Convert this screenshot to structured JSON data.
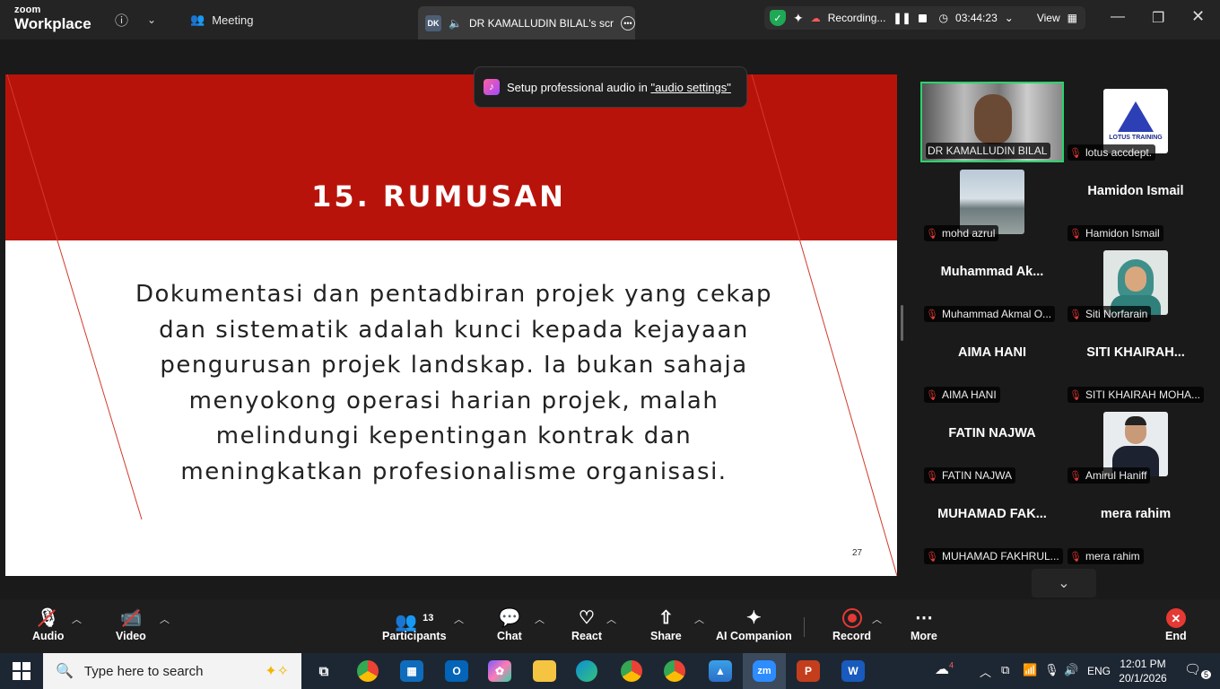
{
  "app": {
    "brand_top": "zoom",
    "brand_bottom": "Workplace"
  },
  "topbar": {
    "meeting_label": "Meeting",
    "share_initials": "DK",
    "share_title": "DR KAMALLUDIN BILAL's scr",
    "recording_label": "Recording...",
    "timer": "03:44:23",
    "view_label": "View"
  },
  "toast": {
    "text": "Setup professional audio in ",
    "link": "\"audio settings\""
  },
  "slide": {
    "title": "15. RUMUSAN",
    "body": "Dokumentasi dan pentadbiran projek yang cekap dan sistematik adalah kunci kepada kejayaan pengurusan projek landskap. Ia bukan sahaja menyokong operasi harian projek, malah melindungi kepentingan kontrak dan meningkatkan profesionalisme organisasi.",
    "page_number": "27",
    "accent_color": "#b8130a"
  },
  "participants": [
    {
      "label": "DR KAMALLUDIN BILAL",
      "big_name": "",
      "kind": "video",
      "muted": false
    },
    {
      "label": "lotus accdept.",
      "big_name": "",
      "kind": "logo",
      "logo_text": "LOTUS TRAINING",
      "muted": true
    },
    {
      "label": "mohd azrul",
      "big_name": "",
      "kind": "photo",
      "muted": true
    },
    {
      "label": "Hamidon Ismail",
      "big_name": "Hamidon Ismail",
      "kind": "name",
      "muted": true
    },
    {
      "label": "Muhammad Akmal O...",
      "big_name": "Muhammad  Ak...",
      "kind": "name",
      "muted": true
    },
    {
      "label": "Siti Norfarain",
      "big_name": "",
      "kind": "photo",
      "muted": true
    },
    {
      "label": "AIMA HANI",
      "big_name": "AIMA HANI",
      "kind": "name",
      "muted": true
    },
    {
      "label": "SITI KHAIRAH MOHA...",
      "big_name": "SITI  KHAIRAH...",
      "kind": "name",
      "muted": true
    },
    {
      "label": "FATIN NAJWA",
      "big_name": "FATIN NAJWA",
      "kind": "name",
      "muted": true
    },
    {
      "label": "Amirul Haniff",
      "big_name": "",
      "kind": "photo",
      "muted": true
    },
    {
      "label": "MUHAMAD FAKHRUL...",
      "big_name": "MUHAMAD  FAK...",
      "kind": "name",
      "muted": true
    },
    {
      "label": "mera rahim",
      "big_name": "mera rahim",
      "kind": "name",
      "muted": true
    }
  ],
  "toolbar": {
    "audio": "Audio",
    "video": "Video",
    "participants": "Participants",
    "participants_count": "13",
    "chat": "Chat",
    "react": "React",
    "share": "Share",
    "ai_companion": "AI Companion",
    "record": "Record",
    "more": "More",
    "end": "End"
  },
  "taskbar": {
    "search_placeholder": "Type here to search",
    "weather_badge": "4",
    "language": "ENG",
    "time": "12:01 PM",
    "date": "20/1/2026",
    "notification_count": "5"
  }
}
